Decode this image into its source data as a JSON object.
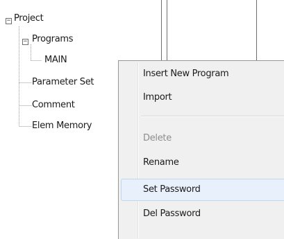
{
  "tree": {
    "nodes": [
      {
        "label": "Project"
      },
      {
        "label": "Programs"
      },
      {
        "label": "MAIN"
      },
      {
        "label": "Parameter Set"
      },
      {
        "label": "Comment"
      },
      {
        "label": "Elem Memory"
      }
    ],
    "expander_glyph": "−",
    "selected": "MAIN"
  },
  "context_menu": {
    "items": [
      {
        "label": "Insert New Program",
        "enabled": true
      },
      {
        "label": "Import",
        "enabled": true
      },
      {
        "label": "Delete",
        "enabled": false
      },
      {
        "label": "Rename",
        "enabled": true
      },
      {
        "label": "Set Password",
        "enabled": true,
        "hovered": true
      },
      {
        "label": "Del Password",
        "enabled": true
      }
    ]
  },
  "colors": {
    "menu_background": "#f0f0f0",
    "menu_hover": "#e8f1fb",
    "disabled_text": "#8d8d8d"
  }
}
